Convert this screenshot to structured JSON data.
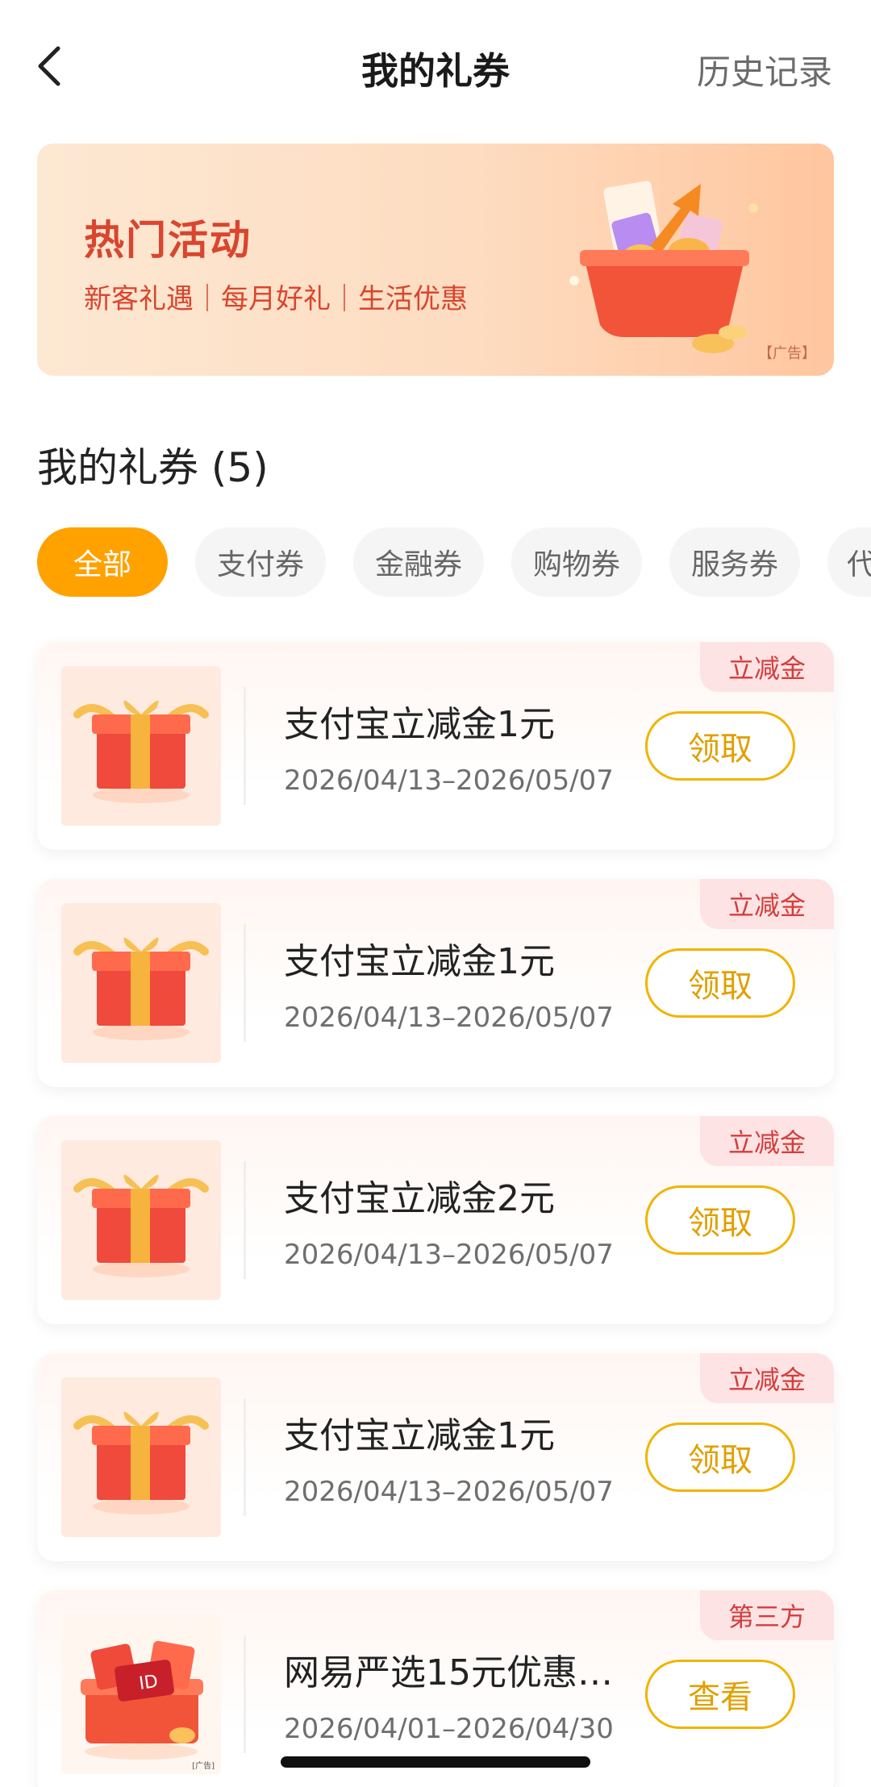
{
  "header": {
    "title": "我的礼券",
    "history_label": "历史记录"
  },
  "banner": {
    "title": "热门活动",
    "subtitle": "新客礼遇｜每月好礼｜生活优惠",
    "ad_tag": "【广告】"
  },
  "section": {
    "title": "我的礼券 (5)"
  },
  "tabs": [
    {
      "label": "全部",
      "active": true
    },
    {
      "label": "支付券",
      "active": false
    },
    {
      "label": "金融券",
      "active": false
    },
    {
      "label": "购物券",
      "active": false
    },
    {
      "label": "服务券",
      "active": false
    },
    {
      "label": "代",
      "active": false
    }
  ],
  "coupons": [
    {
      "name": "支付宝立减金1元",
      "date": "2026/04/13–2026/05/07",
      "action": "领取",
      "tag": "立减金",
      "icon": "gift-box-icon"
    },
    {
      "name": "支付宝立减金1元",
      "date": "2026/04/13–2026/05/07",
      "action": "领取",
      "tag": "立减金",
      "icon": "gift-box-icon"
    },
    {
      "name": "支付宝立减金2元",
      "date": "2026/04/13–2026/05/07",
      "action": "领取",
      "tag": "立减金",
      "icon": "gift-box-icon"
    },
    {
      "name": "支付宝立减金1元",
      "date": "2026/04/13–2026/05/07",
      "action": "领取",
      "tag": "立减金",
      "icon": "gift-box-icon"
    },
    {
      "name": "网易严选15元优惠…",
      "date": "2026/04/01–2026/04/30",
      "action": "查看",
      "tag": "第三方",
      "icon": "gift-pile-icon",
      "thumb_tag": "[广告]"
    }
  ],
  "colors": {
    "accent": "#ffa200",
    "button_border": "#f0b400",
    "tag_text": "#d43d3d",
    "banner_text": "#d9452e"
  }
}
